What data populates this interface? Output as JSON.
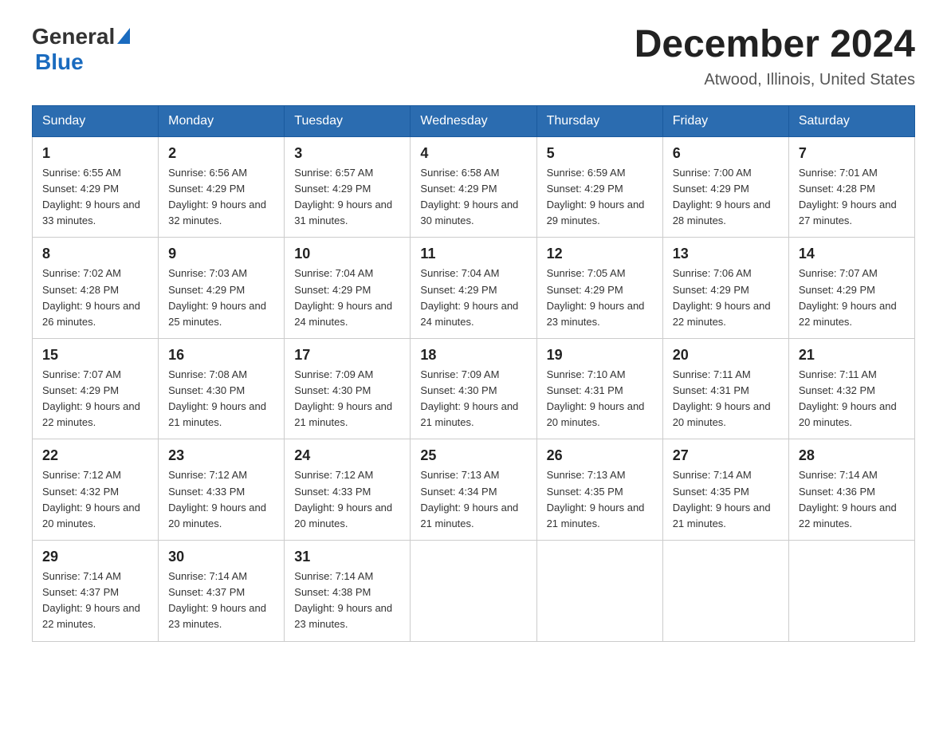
{
  "header": {
    "logo_general": "General",
    "logo_blue": "Blue",
    "month": "December 2024",
    "location": "Atwood, Illinois, United States"
  },
  "days_of_week": [
    "Sunday",
    "Monday",
    "Tuesday",
    "Wednesday",
    "Thursday",
    "Friday",
    "Saturday"
  ],
  "weeks": [
    [
      {
        "day": "1",
        "sunrise": "6:55 AM",
        "sunset": "4:29 PM",
        "daylight": "9 hours and 33 minutes."
      },
      {
        "day": "2",
        "sunrise": "6:56 AM",
        "sunset": "4:29 PM",
        "daylight": "9 hours and 32 minutes."
      },
      {
        "day": "3",
        "sunrise": "6:57 AM",
        "sunset": "4:29 PM",
        "daylight": "9 hours and 31 minutes."
      },
      {
        "day": "4",
        "sunrise": "6:58 AM",
        "sunset": "4:29 PM",
        "daylight": "9 hours and 30 minutes."
      },
      {
        "day": "5",
        "sunrise": "6:59 AM",
        "sunset": "4:29 PM",
        "daylight": "9 hours and 29 minutes."
      },
      {
        "day": "6",
        "sunrise": "7:00 AM",
        "sunset": "4:29 PM",
        "daylight": "9 hours and 28 minutes."
      },
      {
        "day": "7",
        "sunrise": "7:01 AM",
        "sunset": "4:28 PM",
        "daylight": "9 hours and 27 minutes."
      }
    ],
    [
      {
        "day": "8",
        "sunrise": "7:02 AM",
        "sunset": "4:28 PM",
        "daylight": "9 hours and 26 minutes."
      },
      {
        "day": "9",
        "sunrise": "7:03 AM",
        "sunset": "4:29 PM",
        "daylight": "9 hours and 25 minutes."
      },
      {
        "day": "10",
        "sunrise": "7:04 AM",
        "sunset": "4:29 PM",
        "daylight": "9 hours and 24 minutes."
      },
      {
        "day": "11",
        "sunrise": "7:04 AM",
        "sunset": "4:29 PM",
        "daylight": "9 hours and 24 minutes."
      },
      {
        "day": "12",
        "sunrise": "7:05 AM",
        "sunset": "4:29 PM",
        "daylight": "9 hours and 23 minutes."
      },
      {
        "day": "13",
        "sunrise": "7:06 AM",
        "sunset": "4:29 PM",
        "daylight": "9 hours and 22 minutes."
      },
      {
        "day": "14",
        "sunrise": "7:07 AM",
        "sunset": "4:29 PM",
        "daylight": "9 hours and 22 minutes."
      }
    ],
    [
      {
        "day": "15",
        "sunrise": "7:07 AM",
        "sunset": "4:29 PM",
        "daylight": "9 hours and 22 minutes."
      },
      {
        "day": "16",
        "sunrise": "7:08 AM",
        "sunset": "4:30 PM",
        "daylight": "9 hours and 21 minutes."
      },
      {
        "day": "17",
        "sunrise": "7:09 AM",
        "sunset": "4:30 PM",
        "daylight": "9 hours and 21 minutes."
      },
      {
        "day": "18",
        "sunrise": "7:09 AM",
        "sunset": "4:30 PM",
        "daylight": "9 hours and 21 minutes."
      },
      {
        "day": "19",
        "sunrise": "7:10 AM",
        "sunset": "4:31 PM",
        "daylight": "9 hours and 20 minutes."
      },
      {
        "day": "20",
        "sunrise": "7:11 AM",
        "sunset": "4:31 PM",
        "daylight": "9 hours and 20 minutes."
      },
      {
        "day": "21",
        "sunrise": "7:11 AM",
        "sunset": "4:32 PM",
        "daylight": "9 hours and 20 minutes."
      }
    ],
    [
      {
        "day": "22",
        "sunrise": "7:12 AM",
        "sunset": "4:32 PM",
        "daylight": "9 hours and 20 minutes."
      },
      {
        "day": "23",
        "sunrise": "7:12 AM",
        "sunset": "4:33 PM",
        "daylight": "9 hours and 20 minutes."
      },
      {
        "day": "24",
        "sunrise": "7:12 AM",
        "sunset": "4:33 PM",
        "daylight": "9 hours and 20 minutes."
      },
      {
        "day": "25",
        "sunrise": "7:13 AM",
        "sunset": "4:34 PM",
        "daylight": "9 hours and 21 minutes."
      },
      {
        "day": "26",
        "sunrise": "7:13 AM",
        "sunset": "4:35 PM",
        "daylight": "9 hours and 21 minutes."
      },
      {
        "day": "27",
        "sunrise": "7:14 AM",
        "sunset": "4:35 PM",
        "daylight": "9 hours and 21 minutes."
      },
      {
        "day": "28",
        "sunrise": "7:14 AM",
        "sunset": "4:36 PM",
        "daylight": "9 hours and 22 minutes."
      }
    ],
    [
      {
        "day": "29",
        "sunrise": "7:14 AM",
        "sunset": "4:37 PM",
        "daylight": "9 hours and 22 minutes."
      },
      {
        "day": "30",
        "sunrise": "7:14 AM",
        "sunset": "4:37 PM",
        "daylight": "9 hours and 23 minutes."
      },
      {
        "day": "31",
        "sunrise": "7:14 AM",
        "sunset": "4:38 PM",
        "daylight": "9 hours and 23 minutes."
      },
      null,
      null,
      null,
      null
    ]
  ]
}
